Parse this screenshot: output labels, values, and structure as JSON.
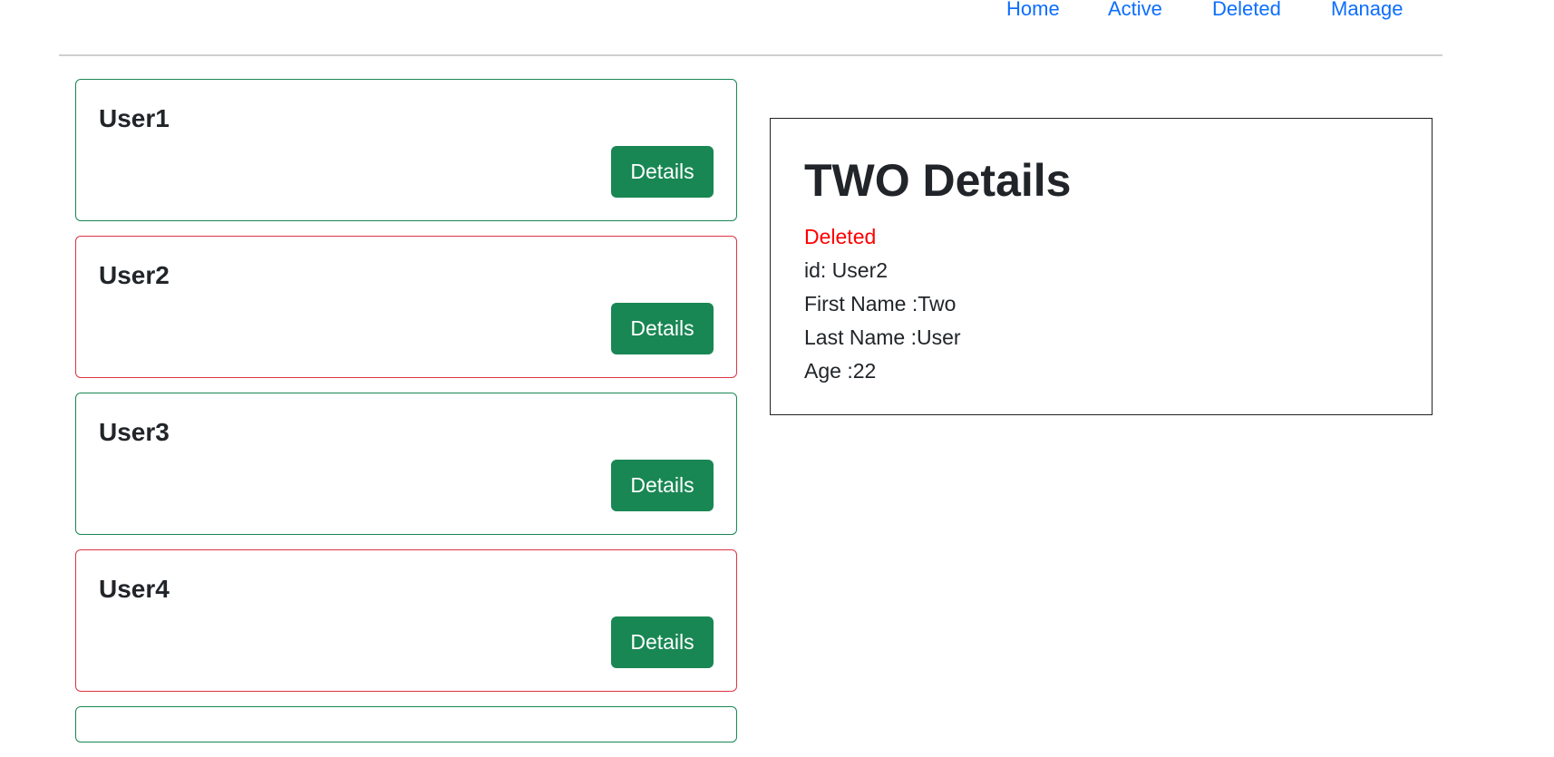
{
  "nav": {
    "links": [
      {
        "label": "Home"
      },
      {
        "label": "Active"
      },
      {
        "label": "Deleted"
      },
      {
        "label": "Manage"
      }
    ]
  },
  "users": [
    {
      "name": "User1",
      "status": "active",
      "button": "Details"
    },
    {
      "name": "User2",
      "status": "deleted",
      "button": "Details"
    },
    {
      "name": "User3",
      "status": "active",
      "button": "Details"
    },
    {
      "name": "User4",
      "status": "deleted",
      "button": "Details"
    }
  ],
  "detail": {
    "title": "TWO Details",
    "status": "Deleted",
    "id_line": "id: User2",
    "first_name_line": "First Name :Two",
    "last_name_line": "Last Name :User",
    "age_line": "Age :22"
  },
  "colors": {
    "active_border": "#198754",
    "deleted_border": "#dc3545",
    "button_bg": "#198754",
    "link": "#0d6efd",
    "deleted_status": "#ff0000"
  }
}
